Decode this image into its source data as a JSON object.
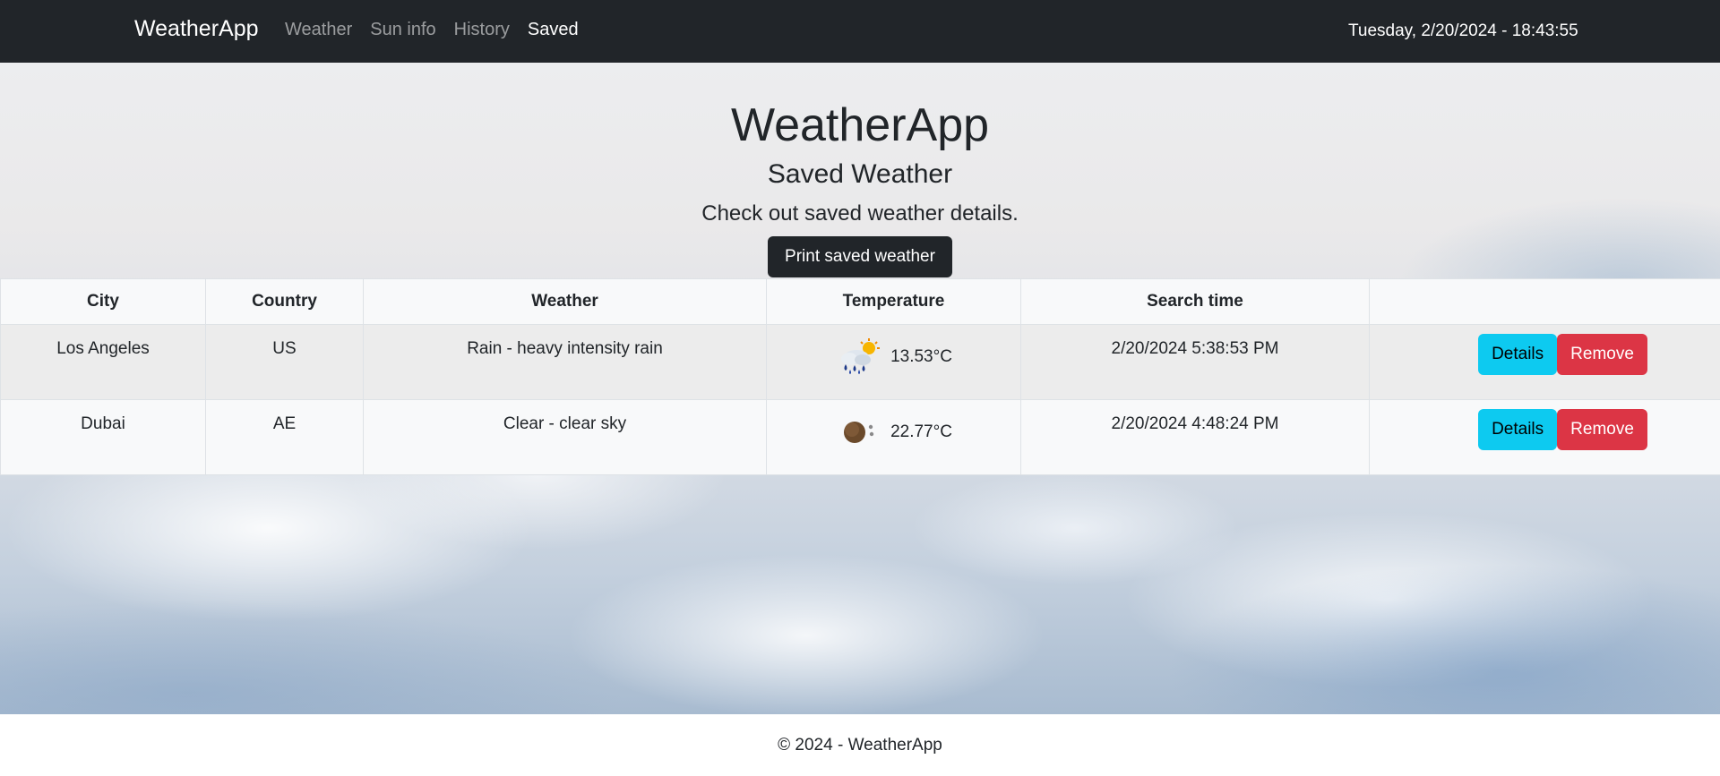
{
  "navbar": {
    "brand": "WeatherApp",
    "links": [
      "Weather",
      "Sun info",
      "History",
      "Saved"
    ],
    "active": "Saved",
    "datetime": "Tuesday, 2/20/2024 - 18:43:55"
  },
  "hero": {
    "title": "WeatherApp",
    "subtitle": "Saved Weather",
    "description": "Check out saved weather details.",
    "print_button": "Print saved weather"
  },
  "table": {
    "headers": [
      "City",
      "Country",
      "Weather",
      "Temperature",
      "Search time",
      ""
    ],
    "rows": [
      {
        "city": "Los Angeles",
        "country": "US",
        "weather": "Rain - heavy intensity rain",
        "icon": "rain-sun-icon",
        "temperature": "13.53°C",
        "search_time": "2/20/2024 5:38:53 PM",
        "details_label": "Details",
        "remove_label": "Remove"
      },
      {
        "city": "Dubai",
        "country": "AE",
        "weather": "Clear - clear sky",
        "icon": "clear-sky-icon",
        "temperature": "22.77°C",
        "search_time": "2/20/2024 4:48:24 PM",
        "details_label": "Details",
        "remove_label": "Remove"
      }
    ]
  },
  "footer": {
    "text": "© 2024 - WeatherApp"
  },
  "colors": {
    "navbar": "#212529",
    "details_button": "#0dcaf0",
    "remove_button": "#dc3545",
    "print_button": "#212529"
  }
}
